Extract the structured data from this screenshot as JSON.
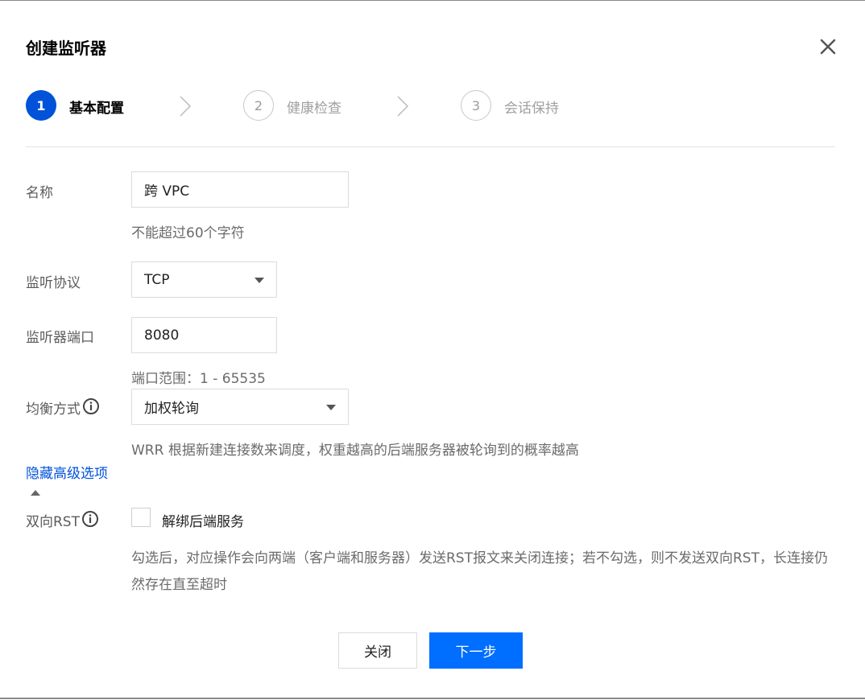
{
  "dialog": {
    "title": "创建监听器"
  },
  "steps": [
    {
      "number": "1",
      "label": "基本配置",
      "active": true
    },
    {
      "number": "2",
      "label": "健康检查",
      "active": false
    },
    {
      "number": "3",
      "label": "会话保持",
      "active": false
    }
  ],
  "form": {
    "name": {
      "label": "名称",
      "value": "跨 VPC",
      "hint": "不能超过60个字符"
    },
    "protocol": {
      "label": "监听协议",
      "value": "TCP"
    },
    "port": {
      "label": "监听器端口",
      "value": "8080",
      "hint": "端口范围：1 - 65535"
    },
    "balance": {
      "label": "均衡方式",
      "value": "加权轮询",
      "hint": "WRR 根据新建连接数来调度，权重越高的后端服务器被轮询到的概率越高"
    },
    "advanced_toggle": "隐藏高级选项",
    "rst": {
      "label": "双向RST",
      "checkbox_label": "解绑后端服务",
      "checked": false,
      "hint": "勾选后，对应操作会向两端（客户端和服务器）发送RST报文来关闭连接；若不勾选，则不发送双向RST，长连接仍然存在直至超时"
    }
  },
  "footer": {
    "close_label": "关闭",
    "next_label": "下一步"
  },
  "colors": {
    "primary": "#0052d9",
    "button_primary": "#006eff",
    "link": "#0052d9"
  }
}
